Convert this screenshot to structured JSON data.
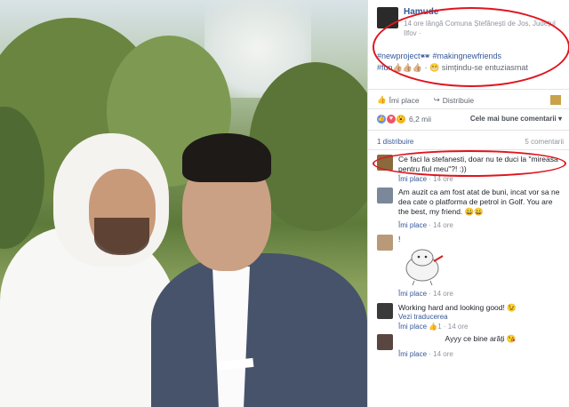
{
  "post": {
    "author": "Hamude",
    "meta": "14 ore lângă Comuna Ștefănești de Jos, Județul Ilfov ·",
    "hashtags": "#newproject🕶 #makingnewfriends",
    "feeling_prefix": "#fun👍🏼👍🏼👍🏼",
    "feeling_text": " · 😬 simțindu-se entuziasmat"
  },
  "actions": {
    "like": "Îmi place",
    "share": "Distribuie"
  },
  "reactions": {
    "count": "6,2 mii",
    "sort": "Cele mai bune comentarii ▾"
  },
  "stats": {
    "shares": "1 distribuire",
    "comments": "5 comentarii"
  },
  "comments": [
    {
      "text": "Ce faci la stefanesti, doar nu te duci la \"mireasa pentru fiul meu\"?! :))",
      "like": "Îmi place",
      "time": "· 14 ore",
      "avatar_color": "#8a6a3c"
    },
    {
      "text": "Am auzit ca am fost atat de buni, incat vor sa ne dea cate o platforma de petrol in Golf. You are the best, my friend. 😀😀",
      "like": "Îmi place",
      "time": "· 14 ore",
      "avatar_color": "#7a8899"
    },
    {
      "text": "!",
      "like": "Îmi place",
      "time": "· 14 ore",
      "avatar_color": "#b89a78"
    },
    {
      "text": "Working hard and looking good! 😉",
      "translate": "Vezi traducerea",
      "like": "Îmi place",
      "likes": "1",
      "time": "· 14 ore",
      "avatar_color": "#3a3a3a"
    },
    {
      "text": "Ayyy ce bine arăți 😘",
      "like": "Îmi place",
      "time": "· 14 ore",
      "avatar_color": "#5a4640"
    }
  ],
  "colors": {
    "link": "#365899",
    "highlight": "#e0141e"
  },
  "icons": [
    "like-icon",
    "share-icon",
    "love-react-icon",
    "wow-react-icon"
  ]
}
